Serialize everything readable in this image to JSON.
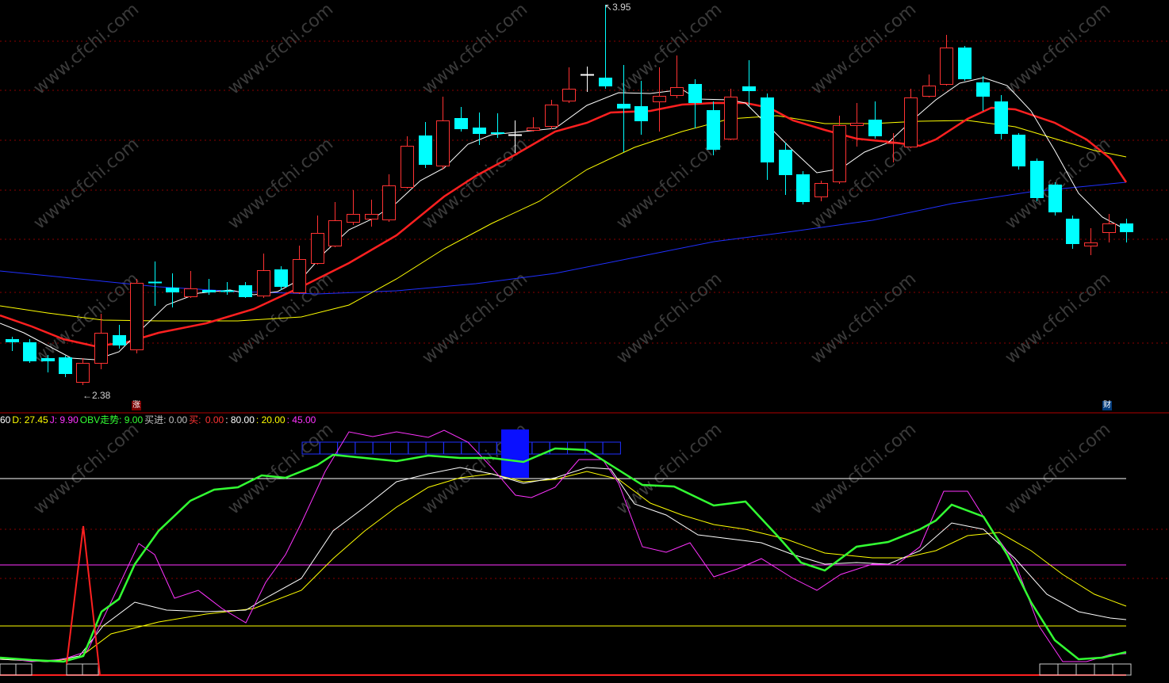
{
  "price_panel": {
    "high_label": "3.95",
    "low_label": "2.38",
    "rise_badge": "涨",
    "finance_badge": "财"
  },
  "indicator_panel": {
    "legend": [
      {
        "key": "k",
        "text": "60",
        "color": "#ffffff"
      },
      {
        "key": "d",
        "text": "D: 27.45",
        "color": "#ffff00"
      },
      {
        "key": "j",
        "text": "J: 9.90",
        "color": "#ff33ff"
      },
      {
        "key": "obv",
        "text": "OBV走势: 9.00",
        "color": "#33ff33"
      },
      {
        "key": "buy_in",
        "text": "买进: 0.00",
        "color": "#c0c0c0"
      },
      {
        "key": "buy_label",
        "text": "买: ",
        "color": "#ff3333"
      },
      {
        "key": "buy_value",
        "text": "0.00",
        "color": "#ff3333"
      },
      {
        "key": "level_80",
        "text": ": 80.00",
        "color": "#ffffff"
      },
      {
        "key": "level_20",
        "text": ": 20.00",
        "color": "#ffff00"
      },
      {
        "key": "level_45",
        "text": ": 45.00",
        "color": "#ff33ff"
      }
    ]
  },
  "watermark": "www.cfchi.com",
  "colors": {
    "up": "#ff3232",
    "down": "#00ffff",
    "ma5": "#ffffff",
    "ma10": "#ff2020",
    "ma20": "#ffff00",
    "ma60": "#2030ff",
    "obv": "#33ff33",
    "j": "#ff33ff",
    "k": "#ffffff",
    "d": "#ffff00",
    "grid": "#8a0000"
  }
}
